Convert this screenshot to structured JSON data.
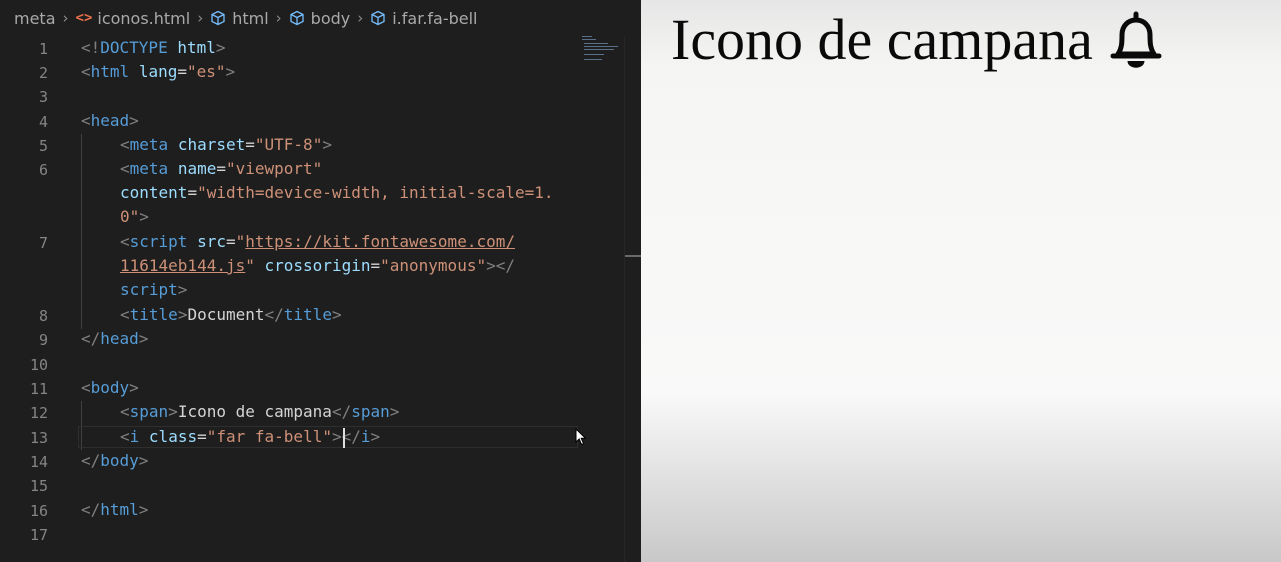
{
  "breadcrumbs": [
    {
      "label": "meta",
      "icon": ""
    },
    {
      "label": "iconos.html",
      "icon": "html-file-icon"
    },
    {
      "label": "html",
      "icon": "cube-icon"
    },
    {
      "label": "body",
      "icon": "cube-icon"
    },
    {
      "label": "i.far.fa-bell",
      "icon": "cube-icon"
    }
  ],
  "line_numbers": [
    "1",
    "2",
    "3",
    "4",
    "5",
    "6",
    "7",
    "8",
    "9",
    "10",
    "11",
    "12",
    "13",
    "14",
    "15",
    "16",
    "17"
  ],
  "code": {
    "l1": {
      "lt": "<!",
      "kw": "DOCTYPE",
      "sp": " ",
      "attr": "html",
      "gt": ">"
    },
    "l2": {
      "lt": "<",
      "tag": "html",
      "sp": " ",
      "attr": "lang",
      "eq": "=",
      "val": "\"es\"",
      "gt": ">"
    },
    "l4": {
      "lt": "<",
      "tag": "head",
      "gt": ">"
    },
    "l5": {
      "lt": "<",
      "tag": "meta",
      "sp": " ",
      "attr": "charset",
      "eq": "=",
      "val": "\"UTF-8\"",
      "gt": ">"
    },
    "l6": {
      "lt": "<",
      "tag": "meta",
      "sp": " ",
      "attr": "name",
      "eq": "=",
      "val": "\"viewport\""
    },
    "l6b": {
      "attr": "content",
      "eq": "=",
      "val": "\"width=device-width, initial-scale=1."
    },
    "l6c": {
      "val": "0\"",
      "gt": ">"
    },
    "l7": {
      "lt": "<",
      "tag": "script",
      "sp": " ",
      "attr": "src",
      "eq": "=",
      "q": "\"",
      "url": "https://kit.fontawesome.com/"
    },
    "l7b": {
      "url": "11614eb144.js",
      "q": "\"",
      "sp": " ",
      "attr": "crossorigin",
      "eq": "=",
      "val": "\"anonymous\"",
      "close": "></"
    },
    "l7c": {
      "tag": "script",
      "gt": ">"
    },
    "l8": {
      "lt": "<",
      "tag": "title",
      "gt": ">",
      "text": "Document",
      "lt2": "</",
      "tag2": "title",
      "gt2": ">"
    },
    "l9": {
      "lt": "</",
      "tag": "head",
      "gt": ">"
    },
    "l11": {
      "lt": "<",
      "tag": "body",
      "gt": ">"
    },
    "l12": {
      "lt": "<",
      "tag": "span",
      "gt": ">",
      "text": "Icono de campana",
      "lt2": "</",
      "tag2": "span",
      "gt2": ">"
    },
    "l13": {
      "lt": "<",
      "tag": "i",
      "sp": " ",
      "attr": "class",
      "eq": "=",
      "val": "\"far fa-bell\"",
      "gt": ">",
      "lt2": "</",
      "tag2": "i",
      "gt2": ">"
    },
    "l14": {
      "lt": "</",
      "tag": "body",
      "gt": ">"
    },
    "l16": {
      "lt": "</",
      "tag": "html",
      "gt": ">"
    }
  },
  "preview": {
    "text": "Icono de campana",
    "icon": "bell-icon"
  },
  "colors": {
    "editor_bg": "#1e1e1e",
    "tag": "#569cd6",
    "attribute": "#9cdcfe",
    "string": "#ce9178",
    "bracket": "#808080",
    "line_number": "#858585"
  }
}
